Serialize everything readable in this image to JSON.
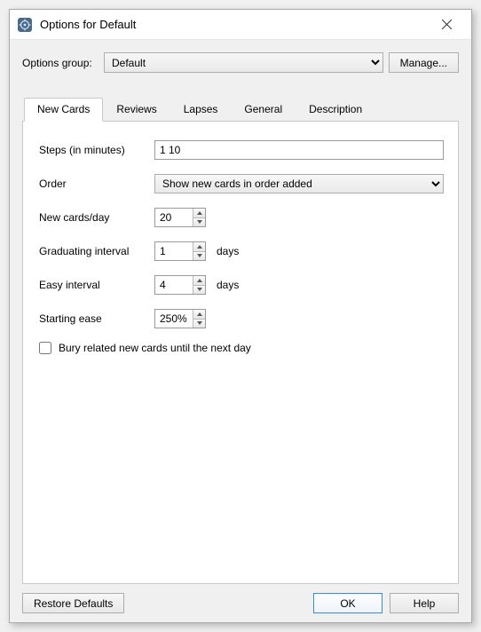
{
  "window": {
    "title": "Options for Default"
  },
  "group": {
    "label": "Options group:",
    "selected": "Default",
    "manage": "Manage..."
  },
  "tabs": {
    "new_cards": "New Cards",
    "reviews": "Reviews",
    "lapses": "Lapses",
    "general": "General",
    "description": "Description"
  },
  "form": {
    "steps_label": "Steps (in minutes)",
    "steps_value": "1 10",
    "order_label": "Order",
    "order_selected": "Show new cards in order added",
    "new_per_day_label": "New cards/day",
    "new_per_day_value": "20",
    "grad_interval_label": "Graduating interval",
    "grad_interval_value": "1",
    "easy_interval_label": "Easy interval",
    "easy_interval_value": "4",
    "days_unit": "days",
    "starting_ease_label": "Starting ease",
    "starting_ease_value": "250%",
    "bury_label": "Bury related new cards until the next day"
  },
  "footer": {
    "restore": "Restore Defaults",
    "ok": "OK",
    "help": "Help"
  }
}
